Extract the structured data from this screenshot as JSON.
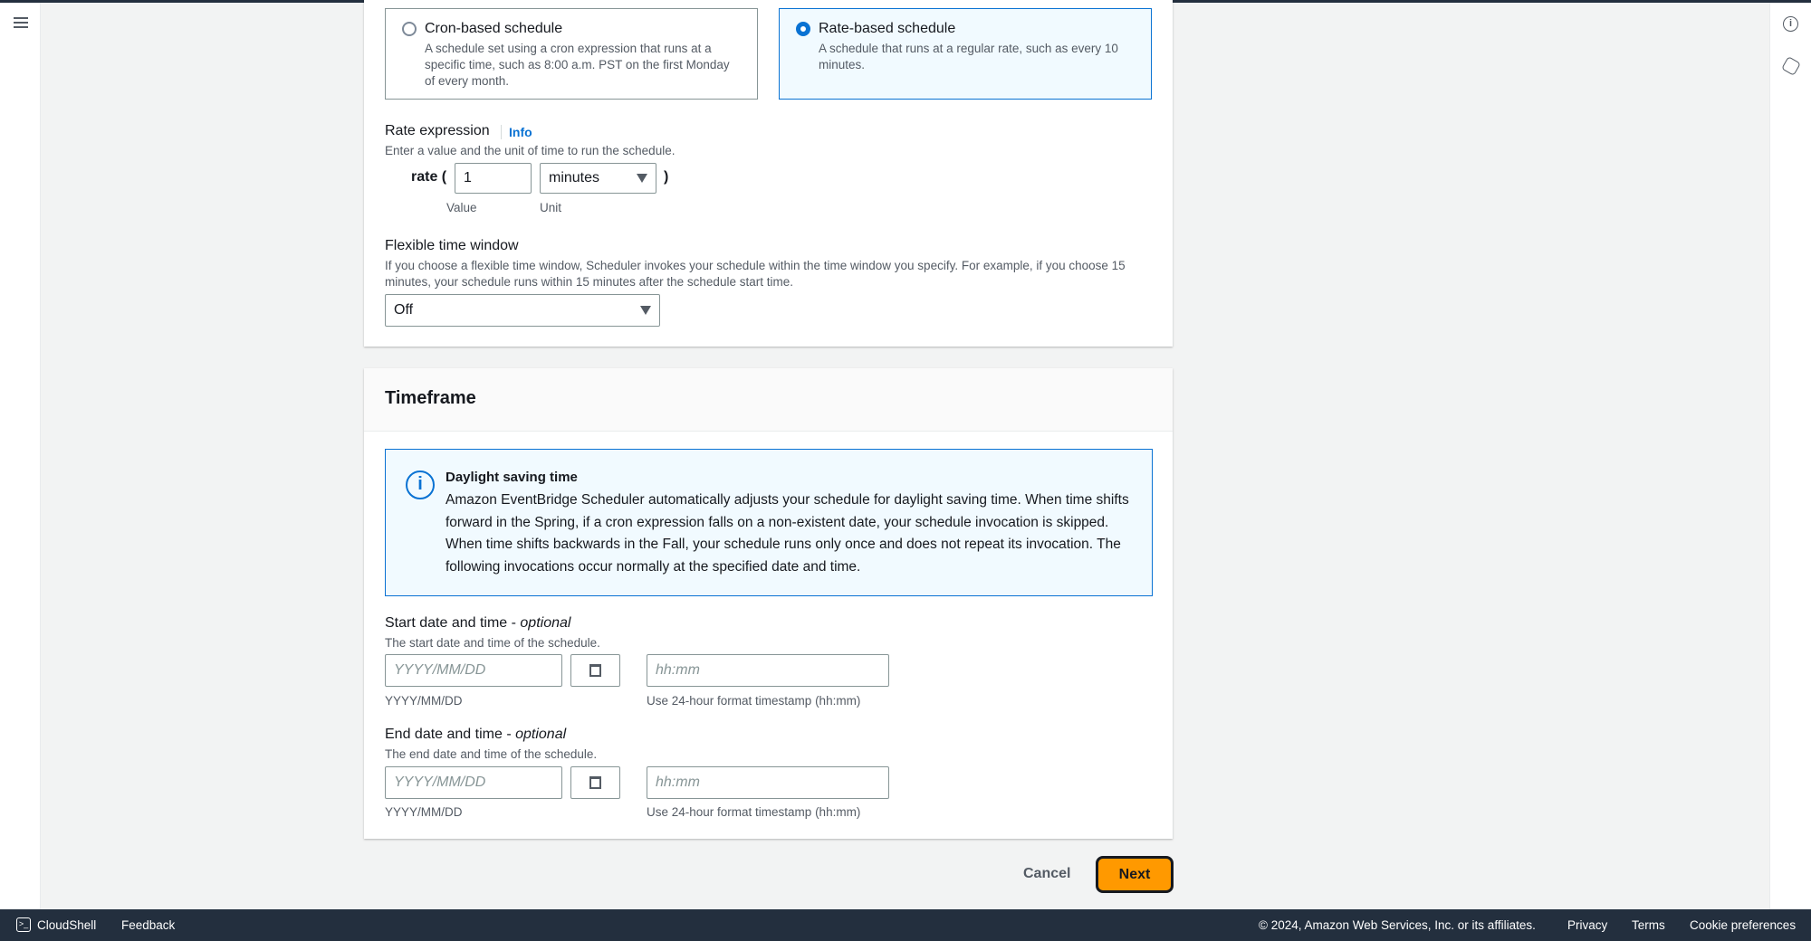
{
  "schedule_types": [
    {
      "title": "Cron-based schedule",
      "description": "A schedule set using a cron expression that runs at a specific time, such as 8:00 a.m. PST on the first Monday of every month.",
      "selected": false
    },
    {
      "title": "Rate-based schedule",
      "description": "A schedule that runs at a regular rate, such as every 10 minutes.",
      "selected": true
    }
  ],
  "rate": {
    "label": "Rate expression",
    "info": "Info",
    "help": "Enter a value and the unit of time to run the schedule.",
    "prefix": "rate (",
    "suffix": ")",
    "value": "1",
    "unit": "minutes",
    "value_label": "Value",
    "unit_label": "Unit"
  },
  "flex": {
    "label": "Flexible time window",
    "help": "If you choose a flexible time window, Scheduler invokes your schedule within the time window you specify. For example, if you choose 15 minutes, your schedule runs within 15 minutes after the schedule start time.",
    "value": "Off"
  },
  "timeframe": {
    "title": "Timeframe",
    "alert": {
      "title": "Daylight saving time",
      "body": "Amazon EventBridge Scheduler automatically adjusts your schedule for daylight saving time. When time shifts forward in the Spring, if a cron expression falls on a non-existent date, your schedule invocation is skipped. When time shifts backwards in the Fall, your schedule runs only once and does not repeat its invocation. The following invocations occur normally at the specified date and time."
    },
    "start": {
      "label": "Start date and time - ",
      "optional": "optional",
      "help": "The start date and time of the schedule.",
      "date_placeholder": "YYYY/MM/DD",
      "time_placeholder": "hh:mm",
      "date_hint": "YYYY/MM/DD",
      "time_hint": "Use 24-hour format timestamp (hh:mm)"
    },
    "end": {
      "label": "End date and time - ",
      "optional": "optional",
      "help": "The end date and time of the schedule.",
      "date_placeholder": "YYYY/MM/DD",
      "time_placeholder": "hh:mm",
      "date_hint": "YYYY/MM/DD",
      "time_hint": "Use 24-hour format timestamp (hh:mm)"
    }
  },
  "actions": {
    "cancel": "Cancel",
    "next": "Next"
  },
  "footer": {
    "cloudshell": "CloudShell",
    "feedback": "Feedback",
    "copyright": "© 2024, Amazon Web Services, Inc. or its affiliates.",
    "privacy": "Privacy",
    "terms": "Terms",
    "cookies": "Cookie preferences"
  },
  "colors": {
    "primary": "#ff9900",
    "link": "#0972d3",
    "footer": "#232f3e"
  }
}
